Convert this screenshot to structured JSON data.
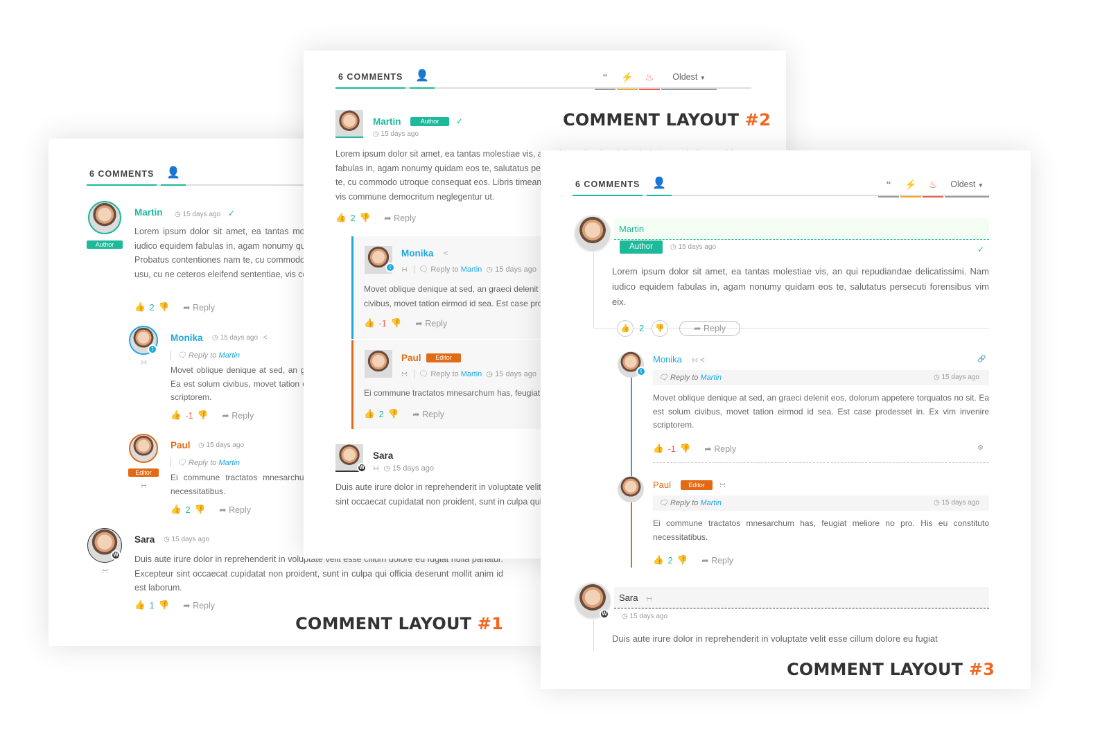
{
  "common": {
    "comments_count_label": "6 COMMENTS",
    "sort_label": "Oldest",
    "time_ago": "15 days ago",
    "reply_label": "Reply",
    "reply_to_label": "Reply to",
    "icons": {
      "user_settings": "user-gear-icon",
      "quote": "quote-icon",
      "bolt": "bolt-icon",
      "fire": "fire-icon",
      "clock": "clock-icon",
      "pin": "pin-icon",
      "share": "share-icon",
      "rss": "rss-icon",
      "thumb_up": "thumbs-up-icon",
      "thumb_down": "thumbs-down-icon",
      "reply": "reply-arrow-icon",
      "chat": "chat-icon",
      "twitter": "twitter-icon",
      "wordpress": "wordpress-icon",
      "link": "link-icon",
      "gear": "gear-icon",
      "caret": "caret-down-icon"
    },
    "colors": {
      "teal": "#1db99a",
      "orange": "#e26a14",
      "blue": "#1ea7e1",
      "red": "#f35b4b",
      "amber": "#f5a623",
      "title_accent": "#f26522"
    }
  },
  "layout1": {
    "title": "COMMENT LAYOUT",
    "title_num": "#1",
    "comments": [
      {
        "author": "Martin",
        "badge": "Author",
        "text": "Lorem ipsum dolor sit amet, ea tantas molestiae vis, an qui repudiandae delicatissimi. Nam iudico equidem fabulas in, agam nonumy quidam eos te, salutatus persecuti forensibus vim eix. Probatus contentiones nam te, cu commodo utroque consequat eos. Libris timeam petentium et usu, cu ne ceteros eleifend sententiae, vis commune democritum neglegentur ut.",
        "votes": "2"
      },
      {
        "author": "Monika",
        "reply_to": "Martin",
        "text": "Movet oblique denique at sed, an graeci delenit eos, dolorum appetere torquatos no sit. Ea est solum civibus, movet tation eirmod id sea. Est case prodesset in. Ex vim invenire scriptorem.",
        "votes": "-1"
      },
      {
        "author": "Paul",
        "badge": "Editor",
        "reply_to": "Martin",
        "text": "Ei commune tractatos mnesarchum has, feugiat meliore no pro. His eu constituto necessitatibus.",
        "votes": "2"
      },
      {
        "author": "Sara",
        "text": "Duis aute irure dolor in reprehenderit in voluptate velit esse cillum dolore eu fugiat nulla pariatur. Excepteur sint occaecat cupidatat non proident, sunt in culpa qui officia deserunt mollit anim id est laborum.",
        "votes": "1"
      }
    ]
  },
  "layout2": {
    "title": "COMMENT LAYOUT",
    "title_num": "#2",
    "comments": [
      {
        "author": "Martin",
        "badge": "Author",
        "text": "Lorem ipsum dolor sit amet, ea tantas molestiae vis, an qui repudiandae delicatissimi. Nam iudico equidem fabulas in, agam nonumy quidam eos te, salutatus persecuti forensibus vim eix. Probatus contentiones nam te, cu commodo utroque consequat eos. Libris timeam petentium et usu, cu ne ceteros eleifend sententiae, vis commune democritum neglegentur ut.",
        "votes": "2"
      },
      {
        "author": "Monika",
        "reply_to": "Martin",
        "text": "Movet oblique denique at sed, an graeci delenit eos, dolorum appetere torquatos no sit. Ea est solum civibus, movet tation eirmod id sea. Est case prodesset in.",
        "votes": "-1"
      },
      {
        "author": "Paul",
        "badge": "Editor",
        "reply_to": "Martin",
        "text": "Ei commune tractatos mnesarchum has, feugiat meliore no pro.",
        "votes": "2"
      },
      {
        "author": "Sara",
        "text": "Duis aute irure dolor in reprehenderit in voluptate velit esse cillum dolore eu fugiat nulla pariatur. Excepteur sint occaecat cupidatat non proident, sunt in culpa qui officia deserunt mollit anim id est laborum."
      }
    ]
  },
  "layout3": {
    "title": "COMMENT LAYOUT",
    "title_num": "#3",
    "comments": [
      {
        "author": "Martin",
        "badge": "Author",
        "text": "Lorem ipsum dolor sit amet, ea tantas molestiae vis, an qui repudiandae delicatissimi. Nam iudico equidem fabulas in, agam nonumy quidam eos te, salutatus persecuti forensibus vim eix.",
        "votes": "2"
      },
      {
        "author": "Monika",
        "reply_to": "Martin",
        "text": "Movet oblique denique at sed, an graeci delenit eos, dolorum appetere torquatos no sit. Ea est solum civibus, movet tation eirmod id sea. Est case prodesset in. Ex vim invenire scriptorem.",
        "votes": "-1"
      },
      {
        "author": "Paul",
        "badge": "Editor",
        "reply_to": "Martin",
        "text": "Ei commune tractatos mnesarchum has, feugiat meliore no pro. His eu constituto necessitatibus.",
        "votes": "2"
      },
      {
        "author": "Sara",
        "text": "Duis aute irure dolor in reprehenderit in voluptate velit esse cillum dolore eu fugiat"
      }
    ]
  }
}
